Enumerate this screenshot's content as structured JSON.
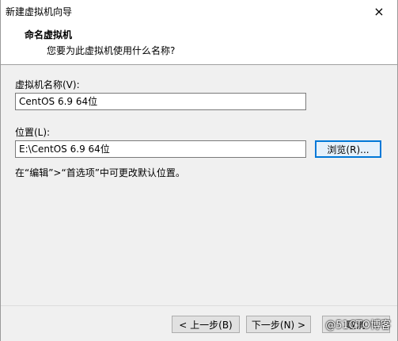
{
  "window": {
    "title": "新建虚拟机向导",
    "close_icon": "×"
  },
  "header": {
    "title": "命名虚拟机",
    "subtitle": "您要为此虚拟机使用什么名称?"
  },
  "vm_name": {
    "label": "虚拟机名称(V):",
    "value": "CentOS 6.9 64位"
  },
  "location": {
    "label": "位置(L):",
    "value": "E:\\CentOS 6.9 64位",
    "browse_label": "浏览(R)..."
  },
  "hint": "在“编辑”>“首选项”中可更改默认位置。",
  "footer": {
    "back_label": "< 上一步(B)",
    "next_label": "下一步(N) >",
    "cancel_label": "取消"
  },
  "watermark": "@51CTO博客"
}
